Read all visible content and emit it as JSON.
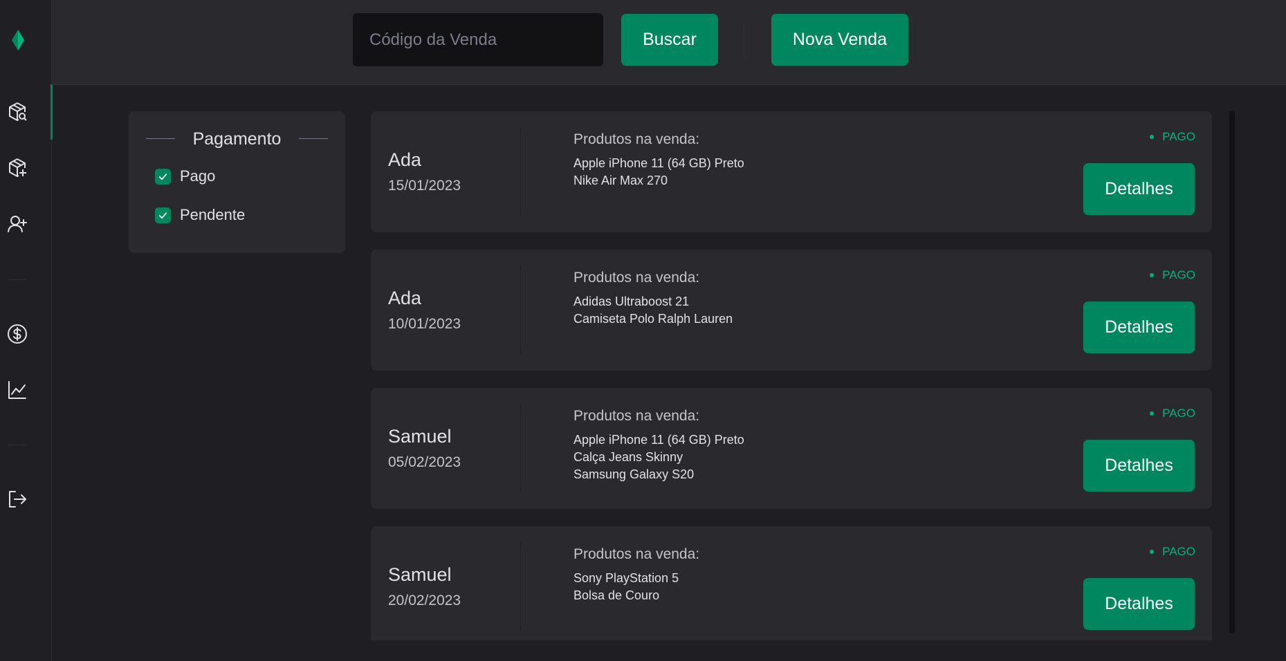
{
  "colors": {
    "accent": "#00875f",
    "status_paid": "#00b37e",
    "background": "#1f1f23",
    "card": "#29292e"
  },
  "sidebar": {
    "logo_icon": "green-diamond-logo",
    "items": [
      {
        "name": "search-products",
        "icon": "package-search-icon",
        "active": true
      },
      {
        "name": "add-product",
        "icon": "package-plus-icon",
        "active": false
      },
      {
        "name": "add-user",
        "icon": "user-plus-icon",
        "active": false
      },
      {
        "name": "sales",
        "icon": "dollar-circle-icon",
        "active": false
      },
      {
        "name": "reports",
        "icon": "chart-line-icon",
        "active": false
      },
      {
        "name": "logout",
        "icon": "sign-out-icon",
        "active": false
      }
    ]
  },
  "toolbar": {
    "search_placeholder": "Código da Venda",
    "search_label": "Buscar",
    "new_sale_label": "Nova Venda"
  },
  "filter": {
    "title": "Pagamento",
    "options": [
      {
        "label": "Pago",
        "checked": true
      },
      {
        "label": "Pendente",
        "checked": true
      }
    ]
  },
  "sales": [
    {
      "name": "Ada",
      "date": "15/01/2023",
      "products_title": "Produtos na venda:",
      "products": [
        "Apple iPhone 11 (64 GB) Preto",
        "Nike Air Max 270"
      ],
      "status": "PAGO",
      "details_label": "Detalhes"
    },
    {
      "name": "Ada",
      "date": "10/01/2023",
      "products_title": "Produtos na venda:",
      "products": [
        "Adidas Ultraboost 21",
        "Camiseta Polo Ralph Lauren"
      ],
      "status": "PAGO",
      "details_label": "Detalhes"
    },
    {
      "name": "Samuel",
      "date": "05/02/2023",
      "products_title": "Produtos na venda:",
      "products": [
        "Apple iPhone 11 (64 GB) Preto",
        "Calça Jeans Skinny",
        "Samsung Galaxy S20"
      ],
      "status": "PAGO",
      "details_label": "Detalhes"
    },
    {
      "name": "Samuel",
      "date": "20/02/2023",
      "products_title": "Produtos na venda:",
      "products": [
        "Sony PlayStation 5",
        "Bolsa de Couro"
      ],
      "status": "PAGO",
      "details_label": "Detalhes"
    }
  ]
}
